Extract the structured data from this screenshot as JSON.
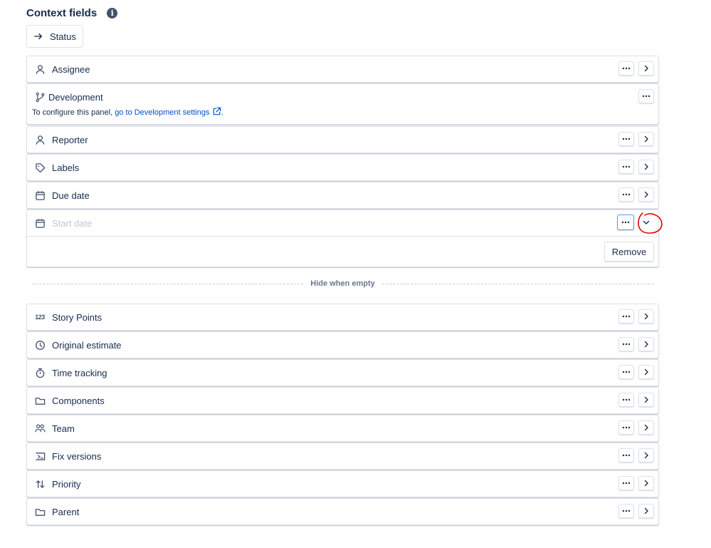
{
  "header": {
    "title": "Context fields",
    "info_icon": "info-icon",
    "info_glyph": "i"
  },
  "status": {
    "label": "Status",
    "icon": "arrow-right-icon"
  },
  "development": {
    "label": "Development",
    "prefix": "To configure this panel, ",
    "link": "go to Development settings",
    "suffix": "."
  },
  "fields": [
    {
      "label": "Assignee",
      "icon": "person-icon"
    },
    {
      "label": "Reporter",
      "icon": "person-icon"
    },
    {
      "label": "Labels",
      "icon": "tag-icon"
    },
    {
      "label": "Due date",
      "icon": "calendar-icon"
    }
  ],
  "start_date": {
    "label": "Start date",
    "icon": "calendar-icon",
    "remove_label": "Remove"
  },
  "divider": {
    "label": "Hide when empty"
  },
  "hidden_fields": [
    {
      "label": "Story Points",
      "icon": "number-icon",
      "glyph": "123"
    },
    {
      "label": "Original estimate",
      "icon": "clock-icon"
    },
    {
      "label": "Time tracking",
      "icon": "stopwatch-icon"
    },
    {
      "label": "Components",
      "icon": "folder-icon"
    },
    {
      "label": "Team",
      "icon": "team-icon"
    },
    {
      "label": "Fix versions",
      "icon": "version-icon"
    },
    {
      "label": "Priority",
      "icon": "sort-arrows-icon"
    },
    {
      "label": "Parent",
      "icon": "folder-icon"
    }
  ],
  "colors": {
    "accent": "#0052cc",
    "focus": "#4c9aff",
    "annotation": "#e60000"
  }
}
